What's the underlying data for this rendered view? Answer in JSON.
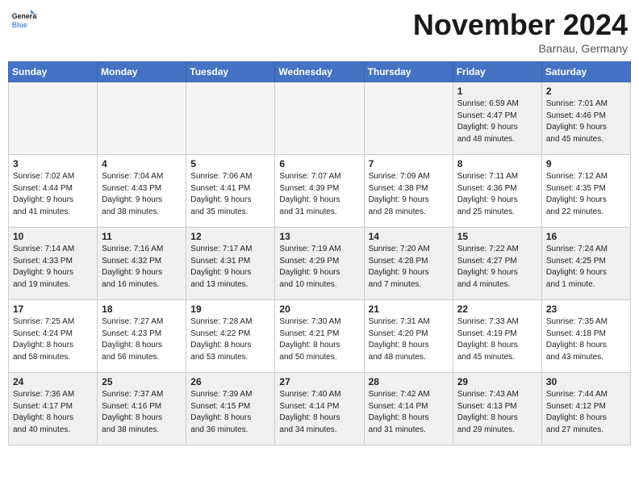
{
  "logo": {
    "line1": "General",
    "line2": "Blue"
  },
  "title": "November 2024",
  "location": "Barnau, Germany",
  "weekdays": [
    "Sunday",
    "Monday",
    "Tuesday",
    "Wednesday",
    "Thursday",
    "Friday",
    "Saturday"
  ],
  "weeks": [
    [
      {
        "day": "",
        "info": "",
        "empty": true
      },
      {
        "day": "",
        "info": "",
        "empty": true
      },
      {
        "day": "",
        "info": "",
        "empty": true
      },
      {
        "day": "",
        "info": "",
        "empty": true
      },
      {
        "day": "",
        "info": "",
        "empty": true
      },
      {
        "day": "1",
        "info": "Sunrise: 6:59 AM\nSunset: 4:47 PM\nDaylight: 9 hours\nand 48 minutes."
      },
      {
        "day": "2",
        "info": "Sunrise: 7:01 AM\nSunset: 4:46 PM\nDaylight: 9 hours\nand 45 minutes."
      }
    ],
    [
      {
        "day": "3",
        "info": "Sunrise: 7:02 AM\nSunset: 4:44 PM\nDaylight: 9 hours\nand 41 minutes."
      },
      {
        "day": "4",
        "info": "Sunrise: 7:04 AM\nSunset: 4:43 PM\nDaylight: 9 hours\nand 38 minutes."
      },
      {
        "day": "5",
        "info": "Sunrise: 7:06 AM\nSunset: 4:41 PM\nDaylight: 9 hours\nand 35 minutes."
      },
      {
        "day": "6",
        "info": "Sunrise: 7:07 AM\nSunset: 4:39 PM\nDaylight: 9 hours\nand 31 minutes."
      },
      {
        "day": "7",
        "info": "Sunrise: 7:09 AM\nSunset: 4:38 PM\nDaylight: 9 hours\nand 28 minutes."
      },
      {
        "day": "8",
        "info": "Sunrise: 7:11 AM\nSunset: 4:36 PM\nDaylight: 9 hours\nand 25 minutes."
      },
      {
        "day": "9",
        "info": "Sunrise: 7:12 AM\nSunset: 4:35 PM\nDaylight: 9 hours\nand 22 minutes."
      }
    ],
    [
      {
        "day": "10",
        "info": "Sunrise: 7:14 AM\nSunset: 4:33 PM\nDaylight: 9 hours\nand 19 minutes."
      },
      {
        "day": "11",
        "info": "Sunrise: 7:16 AM\nSunset: 4:32 PM\nDaylight: 9 hours\nand 16 minutes."
      },
      {
        "day": "12",
        "info": "Sunrise: 7:17 AM\nSunset: 4:31 PM\nDaylight: 9 hours\nand 13 minutes."
      },
      {
        "day": "13",
        "info": "Sunrise: 7:19 AM\nSunset: 4:29 PM\nDaylight: 9 hours\nand 10 minutes."
      },
      {
        "day": "14",
        "info": "Sunrise: 7:20 AM\nSunset: 4:28 PM\nDaylight: 9 hours\nand 7 minutes."
      },
      {
        "day": "15",
        "info": "Sunrise: 7:22 AM\nSunset: 4:27 PM\nDaylight: 9 hours\nand 4 minutes."
      },
      {
        "day": "16",
        "info": "Sunrise: 7:24 AM\nSunset: 4:25 PM\nDaylight: 9 hours\nand 1 minute."
      }
    ],
    [
      {
        "day": "17",
        "info": "Sunrise: 7:25 AM\nSunset: 4:24 PM\nDaylight: 8 hours\nand 58 minutes."
      },
      {
        "day": "18",
        "info": "Sunrise: 7:27 AM\nSunset: 4:23 PM\nDaylight: 8 hours\nand 56 minutes."
      },
      {
        "day": "19",
        "info": "Sunrise: 7:28 AM\nSunset: 4:22 PM\nDaylight: 8 hours\nand 53 minutes."
      },
      {
        "day": "20",
        "info": "Sunrise: 7:30 AM\nSunset: 4:21 PM\nDaylight: 8 hours\nand 50 minutes."
      },
      {
        "day": "21",
        "info": "Sunrise: 7:31 AM\nSunset: 4:20 PM\nDaylight: 8 hours\nand 48 minutes."
      },
      {
        "day": "22",
        "info": "Sunrise: 7:33 AM\nSunset: 4:19 PM\nDaylight: 8 hours\nand 45 minutes."
      },
      {
        "day": "23",
        "info": "Sunrise: 7:35 AM\nSunset: 4:18 PM\nDaylight: 8 hours\nand 43 minutes."
      }
    ],
    [
      {
        "day": "24",
        "info": "Sunrise: 7:36 AM\nSunset: 4:17 PM\nDaylight: 8 hours\nand 40 minutes."
      },
      {
        "day": "25",
        "info": "Sunrise: 7:37 AM\nSunset: 4:16 PM\nDaylight: 8 hours\nand 38 minutes."
      },
      {
        "day": "26",
        "info": "Sunrise: 7:39 AM\nSunset: 4:15 PM\nDaylight: 8 hours\nand 36 minutes."
      },
      {
        "day": "27",
        "info": "Sunrise: 7:40 AM\nSunset: 4:14 PM\nDaylight: 8 hours\nand 34 minutes."
      },
      {
        "day": "28",
        "info": "Sunrise: 7:42 AM\nSunset: 4:14 PM\nDaylight: 8 hours\nand 31 minutes."
      },
      {
        "day": "29",
        "info": "Sunrise: 7:43 AM\nSunset: 4:13 PM\nDaylight: 8 hours\nand 29 minutes."
      },
      {
        "day": "30",
        "info": "Sunrise: 7:44 AM\nSunset: 4:12 PM\nDaylight: 8 hours\nand 27 minutes."
      }
    ]
  ]
}
